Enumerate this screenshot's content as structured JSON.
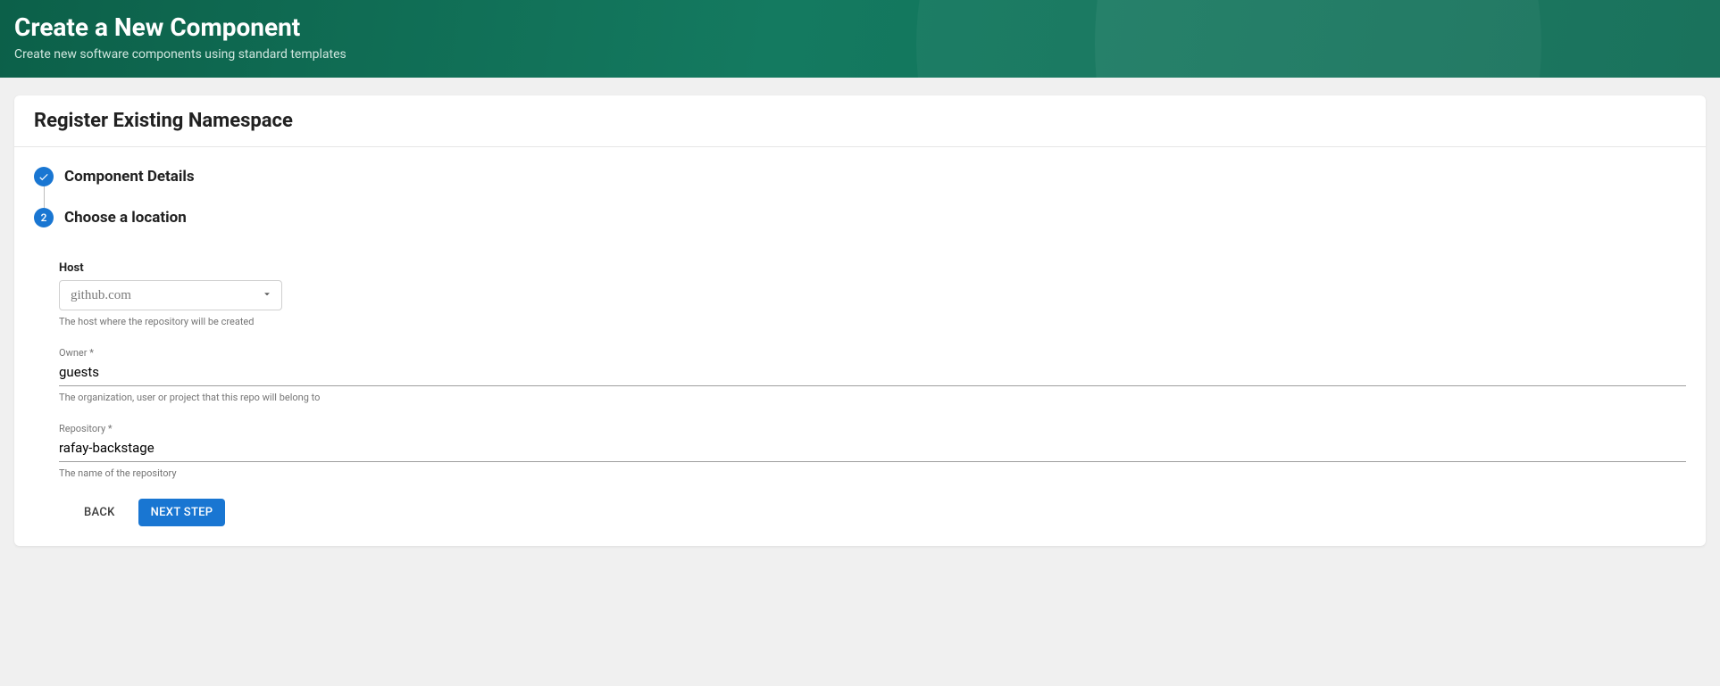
{
  "header": {
    "title": "Create a New Component",
    "subtitle": "Create new software components using standard templates"
  },
  "card": {
    "title": "Register Existing Namespace"
  },
  "steps": {
    "step1_label": "Component Details",
    "step2_number": "2",
    "step2_label": "Choose a location"
  },
  "form": {
    "host": {
      "label": "Host",
      "value": "github.com",
      "helper": "The host where the repository will be created"
    },
    "owner": {
      "label": "Owner *",
      "value": "guests",
      "helper": "The organization, user or project that this repo will belong to"
    },
    "repository": {
      "label": "Repository *",
      "value": "rafay-backstage",
      "helper": "The name of the repository"
    }
  },
  "buttons": {
    "back": "Back",
    "next": "Next Step"
  }
}
